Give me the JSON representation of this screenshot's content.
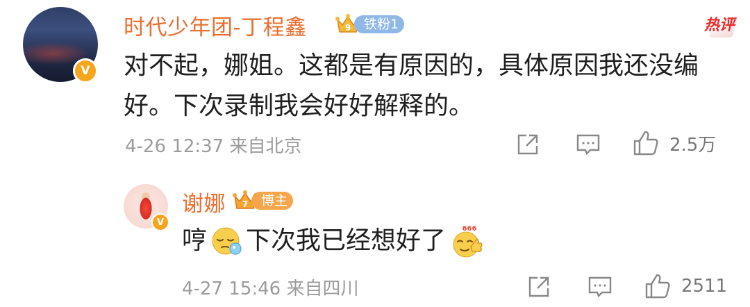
{
  "colors": {
    "username": "#ec6d2d",
    "text": "#1f1f1f",
    "meta": "#9b9b9b",
    "hot_tag": "#ea2a2a",
    "vip_badge": "#f7a51c",
    "fan_badge_blue": "#8fb8e6",
    "fan_badge_orange": "#f6a64a"
  },
  "comment": {
    "avatar_icon": "avatar-dark-sky",
    "verified_icon": "verified-v-badge",
    "verified_text": "V",
    "username": "时代少年团-丁程鑫",
    "fan_badge_icon": "crown-badge-icon",
    "fan_badge_level": "9",
    "fan_badge": "铁粉1",
    "hot_tag": "热评",
    "text": "对不起，娜姐。这都是有原因的，具体原因我还没编好。下次录制我会好好解释的。",
    "date": "4-26 12:37",
    "location": "来自北京",
    "share_icon": "share-icon",
    "reply_icon": "comment-icon",
    "like_icon": "thumbs-up-icon",
    "likes": "2.5万"
  },
  "reply": {
    "avatar_icon": "avatar-red-dress",
    "verified_icon": "verified-v-badge",
    "verified_text": "V",
    "username": "谢娜",
    "fan_badge_icon": "crown-badge-icon",
    "fan_badge_level": "7",
    "fan_badge": "博主",
    "text_start": "哼",
    "emoji_1": "sleepy-snot-emoji",
    "text_mid": "下次我已经想好了",
    "emoji_2": "666-thumbs-up-emoji",
    "emoji_2_text": "666",
    "date": "4-27 15:46",
    "location": "来自四川",
    "share_icon": "share-icon",
    "reply_icon": "comment-icon",
    "like_icon": "thumbs-up-icon",
    "likes": "2511"
  }
}
